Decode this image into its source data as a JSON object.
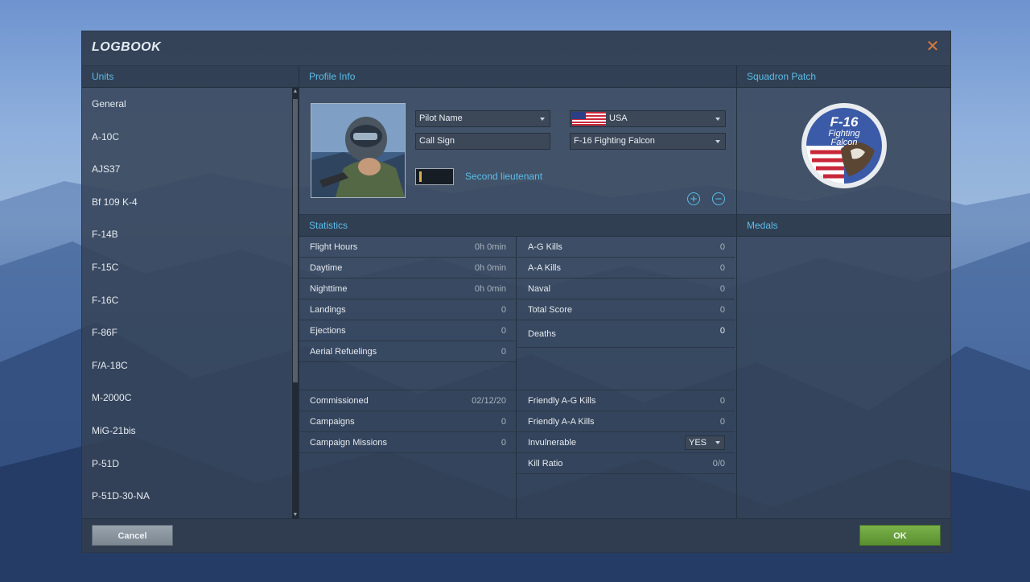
{
  "window": {
    "title": "LOGBOOK",
    "close_icon": "close-icon"
  },
  "units": {
    "header": "Units",
    "items": [
      "General",
      "A-10C",
      "AJS37",
      "Bf 109 K-4",
      "F-14B",
      "F-15C",
      "F-16C",
      "F-86F",
      "F/A-18C",
      "M-2000C",
      "MiG-21bis",
      "P-51D",
      "P-51D-30-NA"
    ]
  },
  "profile": {
    "header": "Profile Info",
    "pilot_name": "Pilot Name",
    "call_sign": "Call Sign",
    "country": "USA",
    "aircraft": "F-16 Fighting Falcon",
    "rank": "Second lieutenant",
    "add_icon": "plus-circle-icon",
    "remove_icon": "minus-circle-icon"
  },
  "squadron": {
    "header": "Squadron Patch",
    "patch_text_1": "F-16",
    "patch_text_2": "Fighting",
    "patch_text_3": "Falcon"
  },
  "statistics": {
    "header": "Statistics",
    "left": [
      {
        "label": "Flight Hours",
        "value": "0h 0min"
      },
      {
        "label": "Daytime",
        "value": "0h 0min"
      },
      {
        "label": "Nighttime",
        "value": "0h 0min"
      },
      {
        "label": "Landings",
        "value": "0"
      },
      {
        "label": "Ejections",
        "value": "0"
      },
      {
        "label": "Aerial Refuelings",
        "value": "0"
      }
    ],
    "right": [
      {
        "label": "A-G Kills",
        "value": "0"
      },
      {
        "label": "A-A Kills",
        "value": "0"
      },
      {
        "label": "Naval",
        "value": "0"
      },
      {
        "label": "Total Score",
        "value": "0"
      },
      {
        "label": "Deaths",
        "value": "0"
      }
    ],
    "left_bottom": [
      {
        "label": "Commissioned",
        "value": "02/12/20"
      },
      {
        "label": "Campaigns",
        "value": "0"
      },
      {
        "label": "Campaign Missions",
        "value": "0"
      }
    ],
    "right_bottom": [
      {
        "label": "Friendly A-G Kills",
        "value": "0"
      },
      {
        "label": "Friendly A-A Kills",
        "value": "0"
      },
      {
        "label": "Invulnerable",
        "value": "YES"
      },
      {
        "label": "Kill Ratio",
        "value": "0/0"
      }
    ]
  },
  "medals": {
    "header": "Medals"
  },
  "footer": {
    "cancel": "Cancel",
    "ok": "OK"
  },
  "colors": {
    "accent": "#5bbde8",
    "ok": "#6aa33d",
    "cancel": "#8a959f",
    "close": "#d97a3c"
  }
}
